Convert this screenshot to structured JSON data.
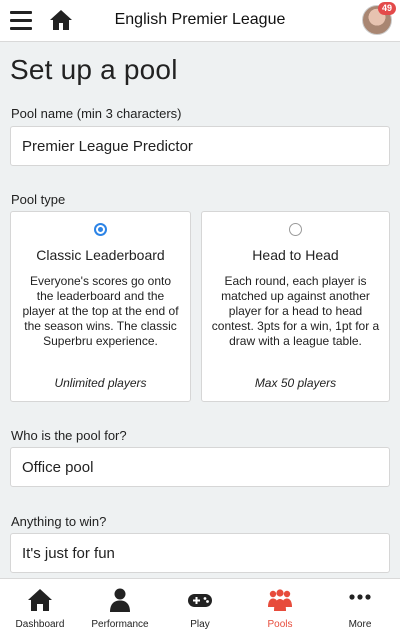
{
  "header": {
    "title": "English Premier League",
    "notification_count": "49"
  },
  "page": {
    "title": "Set up a pool"
  },
  "form": {
    "pool_name_label": "Pool name (min 3 characters)",
    "pool_name_value": "Premier League Predictor",
    "pool_type_label": "Pool type",
    "pool_types": [
      {
        "title": "Classic Leaderboard",
        "description": "Everyone's scores go onto the leaderboard and the player at the top at the end of the season wins. The classic Superbru experience.",
        "limit": "Unlimited players",
        "selected": true
      },
      {
        "title": "Head to Head",
        "description": "Each round, each player is matched up against another player for a head to head contest. 3pts for a win, 1pt for a draw with a league table.",
        "limit": "Max 50 players",
        "selected": false
      }
    ],
    "audience_label": "Who is the pool for?",
    "audience_value": "Office pool",
    "prize_label": "Anything to win?",
    "prize_value": "It's just for fun"
  },
  "nav": {
    "items": [
      {
        "label": "Dashboard",
        "icon": "home-icon"
      },
      {
        "label": "Performance",
        "icon": "person-icon"
      },
      {
        "label": "Play",
        "icon": "gamepad-icon"
      },
      {
        "label": "Pools",
        "icon": "group-icon",
        "active": true
      },
      {
        "label": "More",
        "icon": "more-dots-icon"
      }
    ]
  },
  "colors": {
    "accent": "#2d84e6",
    "active_nav": "#e74c3c",
    "badge": "#e34a4a"
  }
}
